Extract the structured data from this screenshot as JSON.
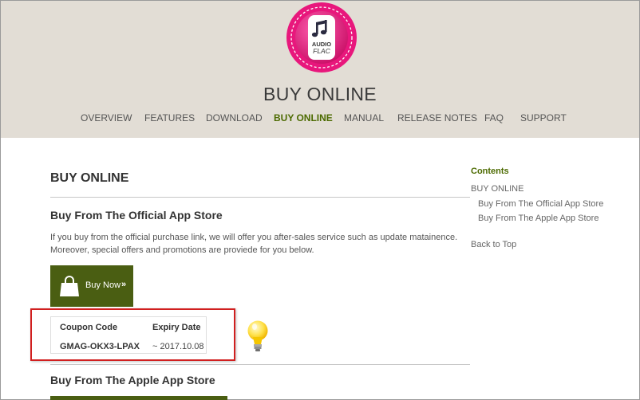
{
  "header": {
    "logo": {
      "icon": "music-note-icon",
      "top_text": "AUDIO",
      "bottom_text": "FLAC",
      "colors": {
        "ring": "#e8177c",
        "inner": "#ffffff"
      }
    },
    "site_title": "BUY ONLINE"
  },
  "nav": {
    "active": "BUY ONLINE",
    "items": [
      "OVERVIEW",
      "FEATURES",
      "DOWNLOAD",
      "BUY ONLINE",
      "MANUAL",
      "RELEASE NOTES",
      "FAQ",
      "SUPPORT"
    ]
  },
  "main": {
    "heading": "BUY ONLINE",
    "official_store": {
      "heading": "Buy From The Official App Store",
      "intro": "If you buy from the official purchase link, we will offer you after-sales service such as update matainence. Moreover, special offers and promotions are proviede for you below.",
      "buy_button": {
        "label": "Buy Now",
        "chevron": "»",
        "icon": "shopping-bag-icon",
        "color": "#4a5e12"
      }
    },
    "coupon": {
      "header_code": "Coupon Code",
      "header_date": "Expiry Date",
      "code": "GMAG-OKX3-LPAX",
      "date": "~ 2017.10.08",
      "highlight_color": "#d11f1f",
      "tip_icon": "light-bulb-icon"
    },
    "apple_store": {
      "heading": "Buy From The Apple App Store"
    }
  },
  "toc": {
    "title": "Contents",
    "items": [
      "BUY ONLINE",
      "Buy From The Official App Store",
      "Buy From The Apple App Store"
    ],
    "back_to_top": "Back to Top"
  },
  "colors": {
    "header_bg": "#e2ddd5",
    "accent": "#4c6a00"
  }
}
